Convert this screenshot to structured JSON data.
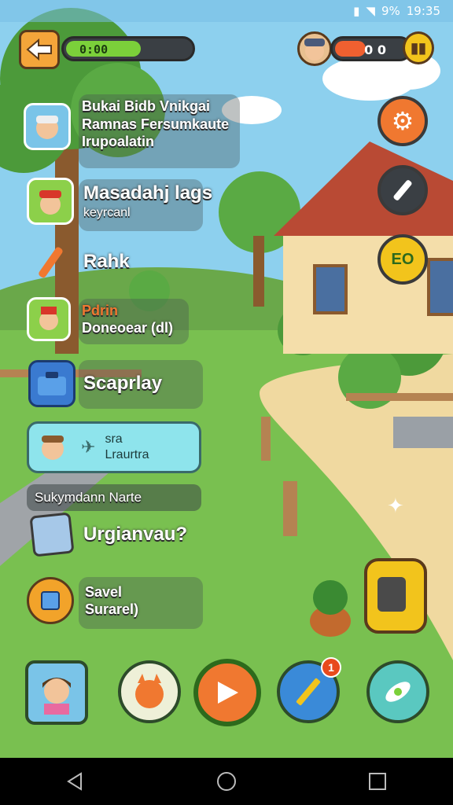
{
  "status_bar": {
    "battery_pct": "9%",
    "time": "19:35"
  },
  "hud": {
    "progress_text": "0:00",
    "progress_fraction": 0.58,
    "energy_text": "0 0",
    "energy_fraction": 0.4
  },
  "menu": {
    "item1": {
      "line1": "Bukai Bidb Vnikgai",
      "line2": "Ramnas Fersumkaute",
      "line3": "Irupoalatin"
    },
    "item2": {
      "line1": "Masadahj lags",
      "line2": "keyrcanl"
    },
    "item3": {
      "label": "Rahk"
    },
    "item4": {
      "line1": "Pdrin",
      "line2": "Doneoear (dl)"
    },
    "item5": {
      "label": "Scaprlay"
    },
    "item6": {
      "line1": "sra",
      "line2": "Lraurtra"
    },
    "item7": {
      "label": "Sukymdann Narte"
    },
    "item8": {
      "label": "Urgianvau?"
    },
    "item9": {
      "line1": "Savel",
      "line2": "Surarel)"
    }
  },
  "side_buttons": {
    "eco_label": "EO"
  },
  "dock": {
    "notifications_badge": "1"
  },
  "colors": {
    "accent_orange": "#f07830",
    "sky": "#7fc5e8",
    "grass": "#79c050"
  }
}
